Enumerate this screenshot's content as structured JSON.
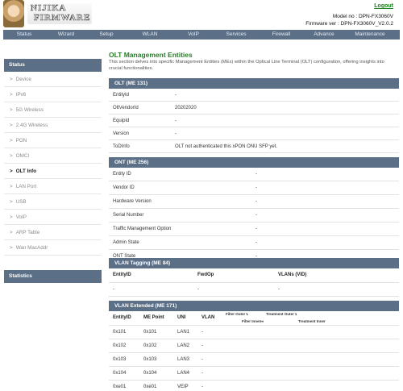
{
  "header": {
    "brand_line1": "NIJIKA",
    "brand_line2": "FIRMWARE",
    "logout": "Logout",
    "model": "Model no : DPN-FX3060V",
    "firmware": "Firmware ver : DPN-FX3060V_V2.0.2"
  },
  "nav": [
    "Status",
    "Wizard",
    "Setup",
    "WLAN",
    "VoIP",
    "Services",
    "Firewall",
    "Advance",
    "Maintenance"
  ],
  "sidebar": {
    "status_header": "Status",
    "items": [
      "Device",
      "IPv6",
      "5G Wireless",
      "2.4G Wireless",
      "PON",
      "OMCI",
      "OLT Info",
      "LAN Port",
      "USB",
      "VoIP",
      "ARP Table",
      "Wan MacAddr"
    ],
    "active_index": 6,
    "statistics_header": "Statistics"
  },
  "main": {
    "title": "OLT Management Entities",
    "description": "This section delves into specific Management Entities (MEs) within the Optical Line Terminal (OLT) configuration, offering insights into crucial functionalities."
  },
  "olt": {
    "header": "OLT (ME 131)",
    "rows": [
      {
        "key": "EntityId",
        "value": "-"
      },
      {
        "key": "OltVendorId",
        "value": "20202020"
      },
      {
        "key": "EquipId",
        "value": "-"
      },
      {
        "key": "Version",
        "value": "-"
      },
      {
        "key": "ToDInfo",
        "value": "OLT not authenticated this xPON ONU SFP yet."
      }
    ]
  },
  "ont": {
    "header": "ONT (ME 256)",
    "rows": [
      {
        "key": "Entity ID",
        "value": "-"
      },
      {
        "key": "Vendor ID",
        "value": "-"
      },
      {
        "key": "Hardware Version",
        "value": "-"
      },
      {
        "key": "Serial Number",
        "value": "-"
      },
      {
        "key": "Traffic Management Option",
        "value": "-"
      },
      {
        "key": "Admin State",
        "value": "-"
      },
      {
        "key": "ONT State",
        "value": "-"
      }
    ]
  },
  "vlan_tagging": {
    "header": "VLAN Tagging (ME 84)",
    "columns": [
      "EntityID",
      "FwdOp",
      "VLANs (VID)"
    ],
    "rows": [
      [
        "-",
        "-",
        "-"
      ]
    ]
  },
  "vlan_extended": {
    "header": "VLAN Extended (ME 171)",
    "columns": [
      "EntityID",
      "ME Point",
      "UNI",
      "VLAN"
    ],
    "sub_labels": [
      "Filter Outer↴",
      "Treatment Outer↴",
      "Filter Inner↦",
      "Treatment Inner"
    ],
    "rows": [
      [
        "0x101",
        "0x101",
        "LAN1",
        "-"
      ],
      [
        "0x102",
        "0x102",
        "LAN2",
        "-"
      ],
      [
        "0x103",
        "0x103",
        "LAN3",
        "-"
      ],
      [
        "0x104",
        "0x104",
        "LAN4",
        "-"
      ],
      [
        "0xe01",
        "0xe01",
        "VEIP",
        "-"
      ]
    ]
  },
  "colors": {
    "panel_header": "#5b6f87",
    "title_green": "#2b7a2b",
    "logout_green": "#1a7f1a"
  }
}
